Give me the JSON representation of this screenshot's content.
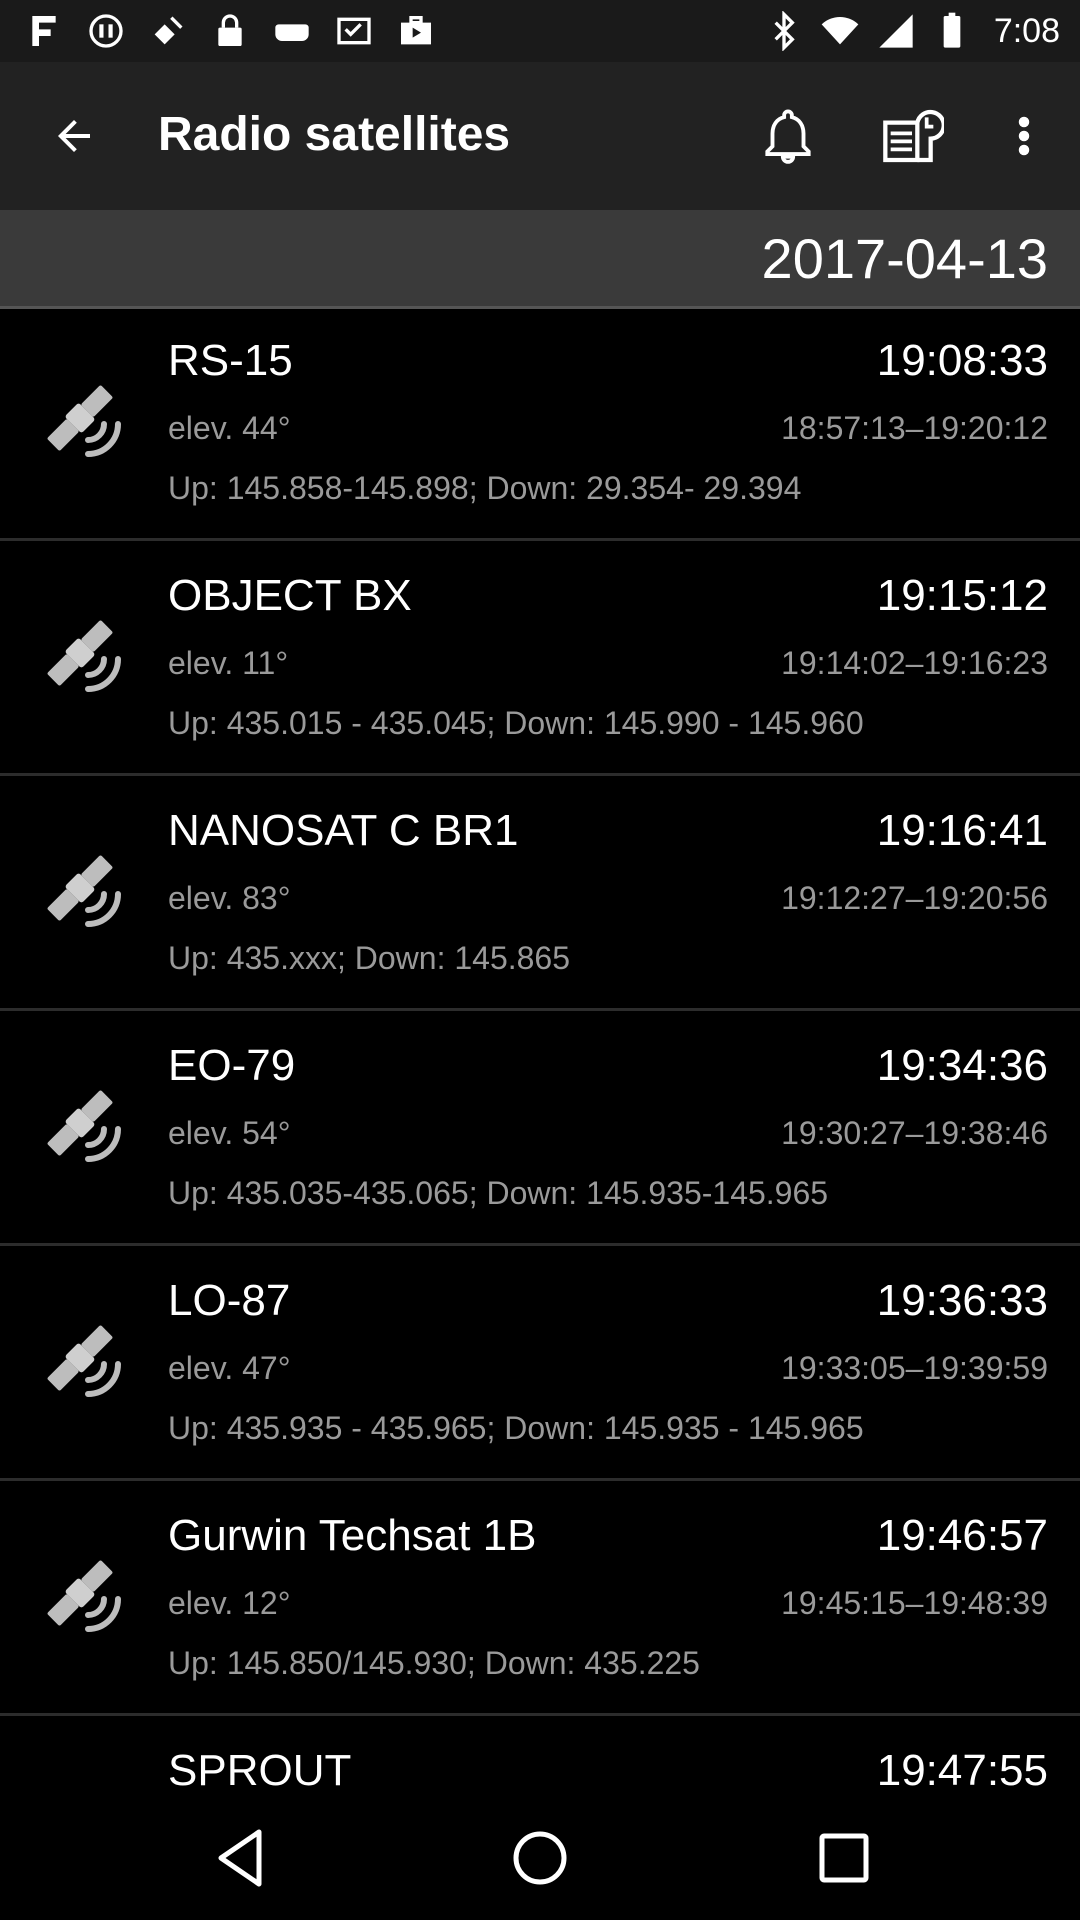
{
  "status_bar": {
    "time": "7:08",
    "left_icons": [
      "star-icon",
      "sync-icon",
      "satellite-icon",
      "lock-icon",
      "game-icon",
      "inbox-icon",
      "play-store-icon"
    ],
    "right_icons": [
      "bluetooth-icon",
      "wifi-icon",
      "signal-icon",
      "battery-icon"
    ]
  },
  "app_bar": {
    "title": "Radio satellites",
    "icons": [
      "back-arrow-icon",
      "bell-icon",
      "news-icon",
      "more-vert-icon"
    ]
  },
  "date_header": "2017-04-13",
  "passes": [
    {
      "name": "RS-15",
      "time": "19:08:33",
      "elev": "elev. 44°",
      "window": "18:57:13–19:20:12",
      "freq": "Up: 145.858-145.898; Down: 29.354- 29.394"
    },
    {
      "name": "OBJECT BX",
      "time": "19:15:12",
      "elev": "elev. 11°",
      "window": "19:14:02–19:16:23",
      "freq": "Up: 435.015 - 435.045; Down: 145.990 - 145.960"
    },
    {
      "name": "NANOSAT C BR1",
      "time": "19:16:41",
      "elev": "elev. 83°",
      "window": "19:12:27–19:20:56",
      "freq": "Up: 435.xxx; Down: 145.865"
    },
    {
      "name": "EO-79",
      "time": "19:34:36",
      "elev": "elev. 54°",
      "window": "19:30:27–19:38:46",
      "freq": "Up: 435.035-435.065; Down: 145.935-145.965"
    },
    {
      "name": "LO-87",
      "time": "19:36:33",
      "elev": "elev. 47°",
      "window": "19:33:05–19:39:59",
      "freq": "Up: 435.935 - 435.965; Down: 145.935 - 145.965"
    },
    {
      "name": "Gurwin Techsat 1B",
      "time": "19:46:57",
      "elev": "elev. 12°",
      "window": "19:45:15–19:48:39",
      "freq": "Up: 145.850/145.930; Down: 435.225"
    },
    {
      "name": "SPROUT",
      "time": "19:47:55",
      "elev": "",
      "window": "",
      "freq": ""
    }
  ],
  "nav_bar": {
    "icons": [
      "nav-back-icon",
      "nav-home-icon",
      "nav-recent-icon"
    ]
  },
  "colors": {
    "background": "#000000",
    "app_bar": "#222222",
    "date_header": "#3a3a3a",
    "primary_text": "#ffffff",
    "secondary_text": "#9a9a9a"
  }
}
